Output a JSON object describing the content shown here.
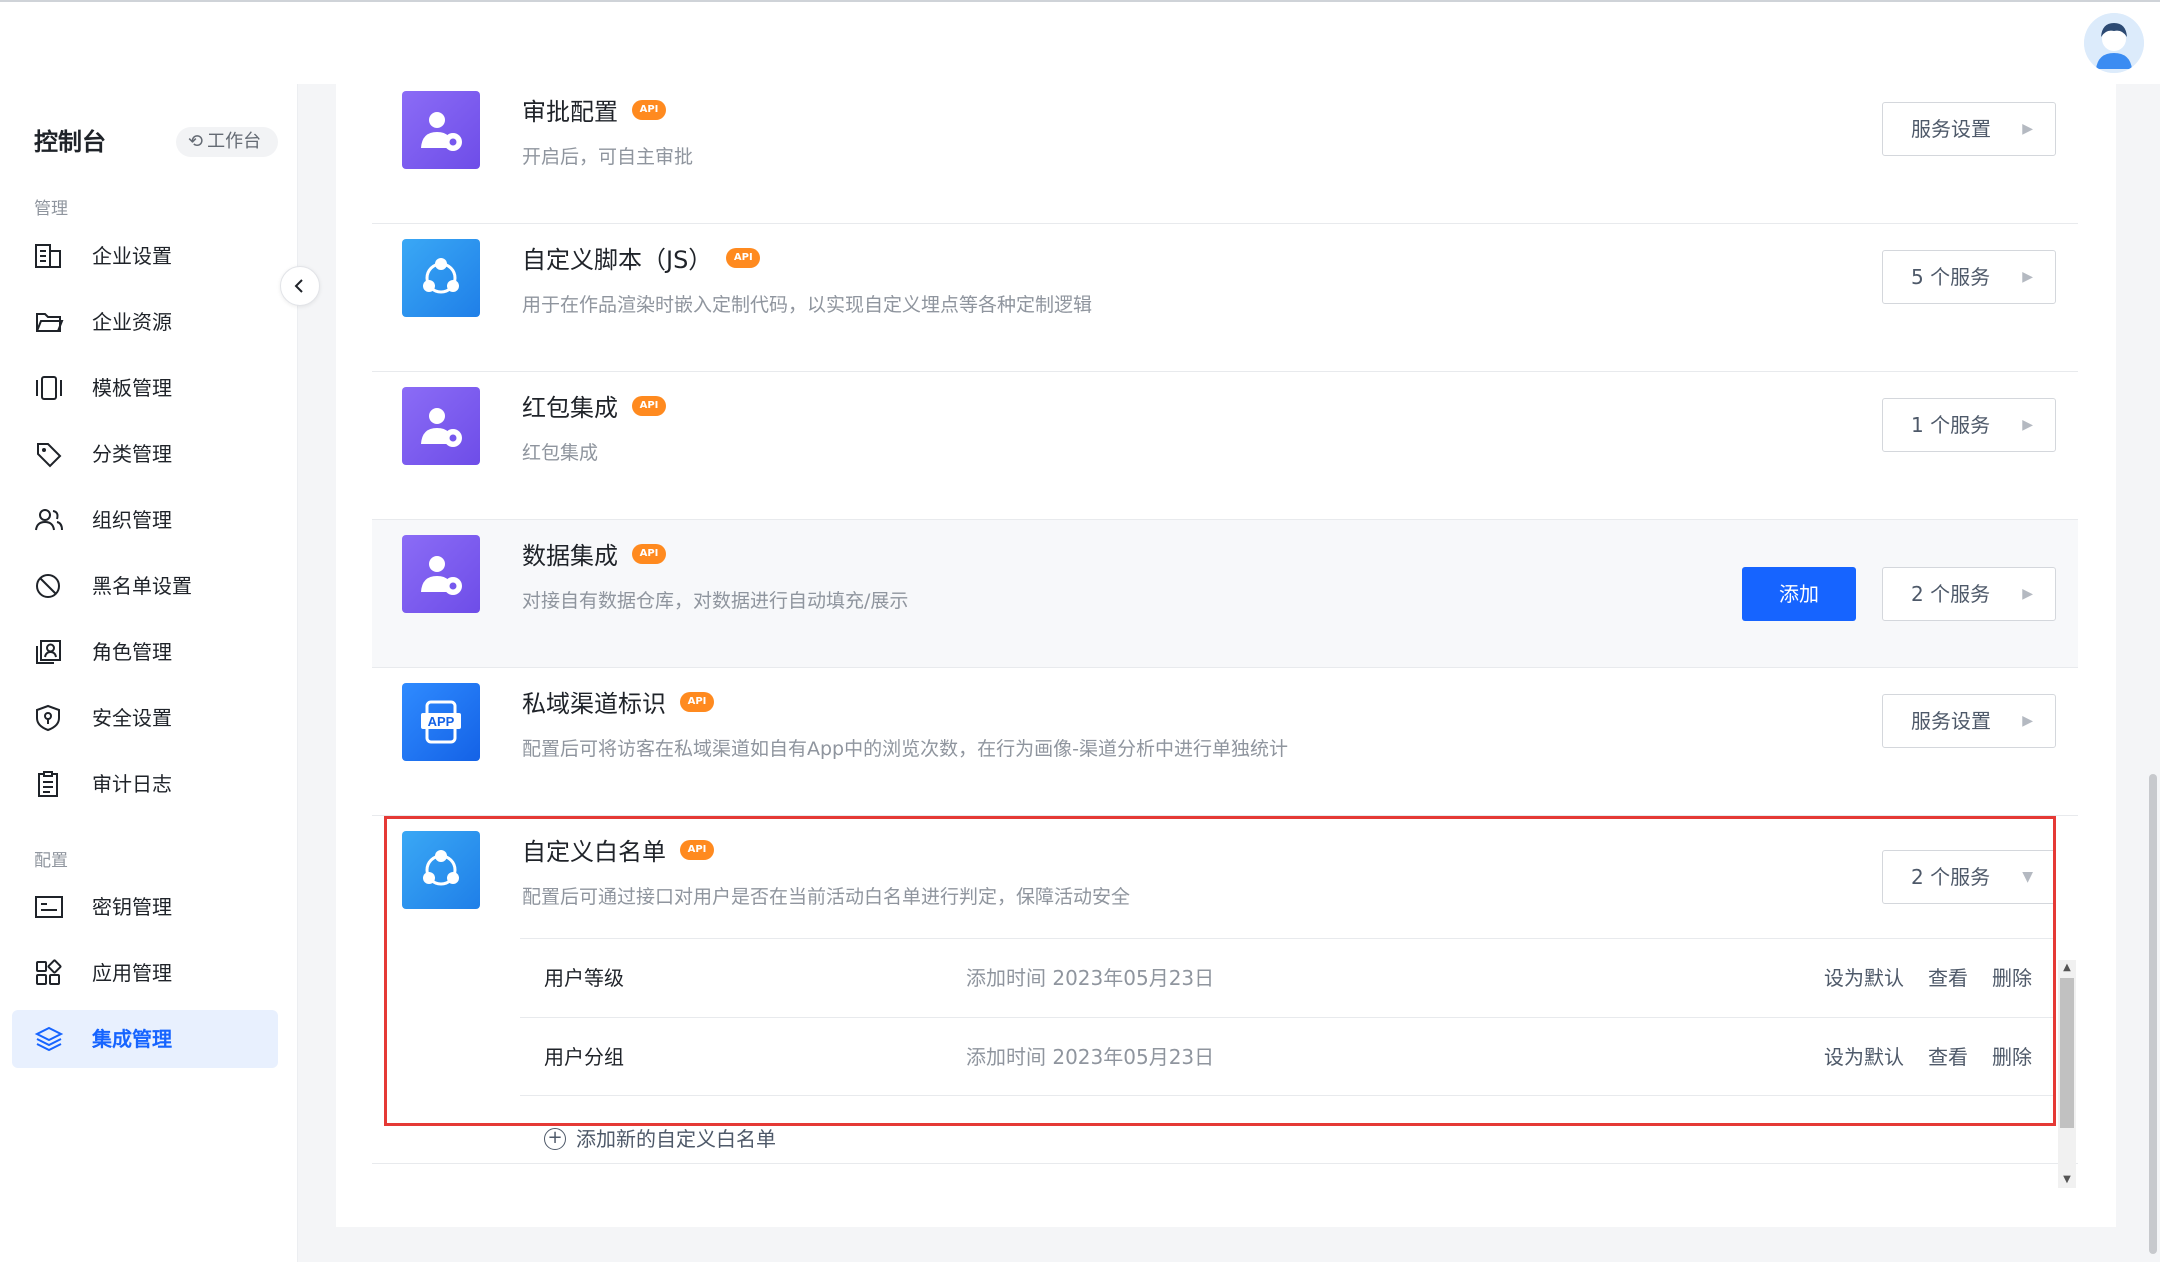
{
  "colors": {
    "primary": "#1664ff",
    "api_badge": "#ff8a1f",
    "highlight": "#e53935"
  },
  "sidebar": {
    "title": "控制台",
    "workbench_label": "工作台",
    "section_manage": "管理",
    "section_config": "配置",
    "items": [
      {
        "label": "企业设置",
        "icon": "building-icon"
      },
      {
        "label": "企业资源",
        "icon": "folder-icon"
      },
      {
        "label": "模板管理",
        "icon": "template-icon"
      },
      {
        "label": "分类管理",
        "icon": "tag-icon"
      },
      {
        "label": "组织管理",
        "icon": "users-icon"
      },
      {
        "label": "黑名单设置",
        "icon": "ban-icon"
      },
      {
        "label": "角色管理",
        "icon": "role-icon"
      },
      {
        "label": "安全设置",
        "icon": "shield-icon"
      },
      {
        "label": "审计日志",
        "icon": "clipboard-icon"
      },
      {
        "label": "密钥管理",
        "icon": "key-card-icon"
      },
      {
        "label": "应用管理",
        "icon": "apps-icon"
      },
      {
        "label": "集成管理",
        "icon": "layers-icon",
        "active": true
      }
    ]
  },
  "integrations": [
    {
      "name": "审批配置",
      "badge": "API",
      "desc": "开启后，可自主审批",
      "button": "服务设置"
    },
    {
      "name": "自定义脚本（JS）",
      "badge": "API",
      "desc": "用于在作品渲染时嵌入定制代码，以实现自定义埋点等各种定制逻辑",
      "button": "5 个服务"
    },
    {
      "name": "红包集成",
      "badge": "API",
      "desc": "红包集成",
      "button": "1 个服务"
    },
    {
      "name": "数据集成",
      "badge": "API",
      "desc": "对接自有数据仓库，对数据进行自动填充/展示",
      "button": "2 个服务",
      "add_label": "添加"
    },
    {
      "name": "私域渠道标识",
      "badge": "API",
      "desc": "配置后可将访客在私域渠道如自有App中的浏览次数，在行为画像-渠道分析中进行单独统计",
      "button": "服务设置"
    }
  ],
  "whitelist": {
    "name": "自定义白名单",
    "badge": "API",
    "desc": "配置后可通过接口对用户是否在当前活动白名单进行判定，保障活动安全",
    "button": "2 个服务",
    "entries": [
      {
        "name": "用户等级",
        "time": "添加时间 2023年05月23日",
        "set_default": "设为默认",
        "view": "查看",
        "delete": "删除"
      },
      {
        "name": "用户分组",
        "time": "添加时间 2023年05月23日",
        "set_default": "设为默认",
        "view": "查看",
        "delete": "删除"
      }
    ],
    "add_new": "添加新的自定义白名单"
  },
  "app_icon_text": "APP"
}
